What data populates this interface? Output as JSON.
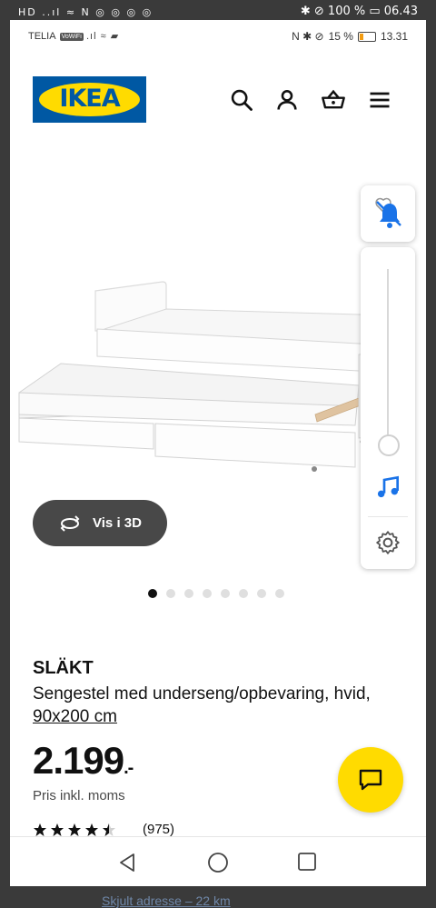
{
  "outer_status": {
    "left": "HD ..ıl ≈ N ◎ ◎ ◎ ◎",
    "right": "✱ ⊘ 100 % ▭ 06.43"
  },
  "status_bar": {
    "carrier": "TELIA",
    "wifi_badge": "VoWiFi",
    "battery": "15 %",
    "time": "13.31"
  },
  "header": {
    "logo": "IKEA"
  },
  "gallery": {
    "view3d_label": "Vis i 3D",
    "dot_count": 8,
    "active_index": 0
  },
  "product": {
    "name": "SLÄKT",
    "description": "Sengestel med underseng/opbevaring, hvid,",
    "size": "90x200 cm",
    "price": "2.199",
    "price_suffix": ".-",
    "vat_note": "Pris inkl. moms",
    "rating_value": 4.5,
    "review_count": "(975)"
  },
  "peek": {
    "text": "Skjult adresse – 22 km"
  },
  "colors": {
    "ikea_blue": "#0058a3",
    "ikea_yellow": "#ffdb00",
    "accent_blue": "#1a73e8"
  }
}
